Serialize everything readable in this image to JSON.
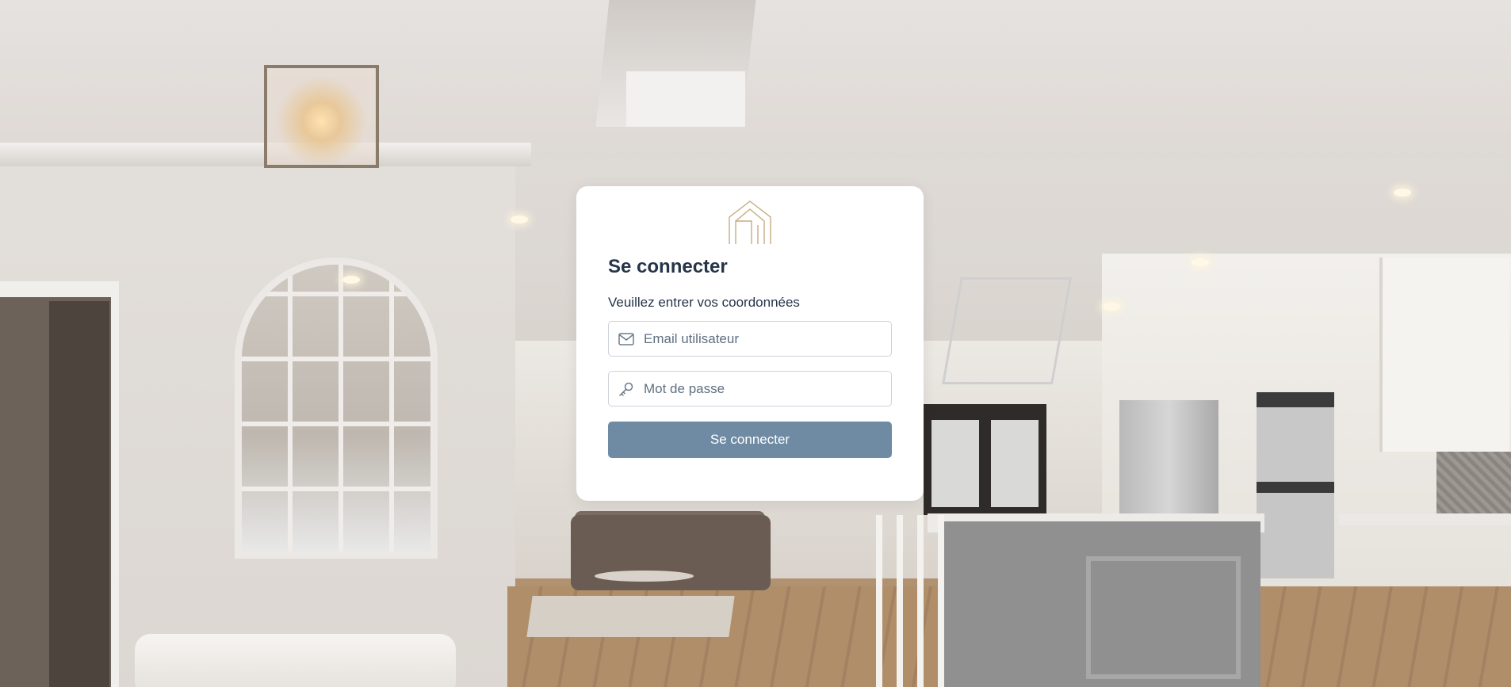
{
  "login": {
    "title": "Se connecter",
    "subtitle": "Veuillez entrer vos coordonnées",
    "email": {
      "placeholder": "Email utilisateur",
      "value": "",
      "icon": "envelope-icon"
    },
    "password": {
      "placeholder": "Mot de passe",
      "value": "",
      "icon": "key-icon"
    },
    "submit_label": "Se connecter",
    "logo": "house-outline-logo"
  },
  "colors": {
    "card_bg": "#ffffff",
    "text": "#253449",
    "button": "#6e8ba3",
    "logo_gold": "#c8aa82",
    "input_border": "#cdd3da"
  }
}
